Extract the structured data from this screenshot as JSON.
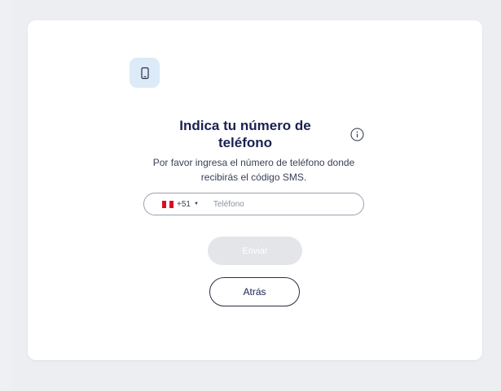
{
  "screen": {
    "title": "Indica tu número de teléfono",
    "subtitle": "Por favor ingresa el número de teléfono donde recibirás el código SMS."
  },
  "phone_field": {
    "country_flag": "peru-flag",
    "dial_code": "+51",
    "placeholder": "Teléfono",
    "value": ""
  },
  "buttons": {
    "send_label": "Enviar",
    "back_label": "Atrás"
  },
  "icons": {
    "header": "phone-icon",
    "info": "info-icon"
  },
  "colors": {
    "title": "#1a2150",
    "icon_box_bg": "#dcebf7",
    "send_disabled_bg": "#e4e5e8",
    "flag_red": "#d91023"
  }
}
